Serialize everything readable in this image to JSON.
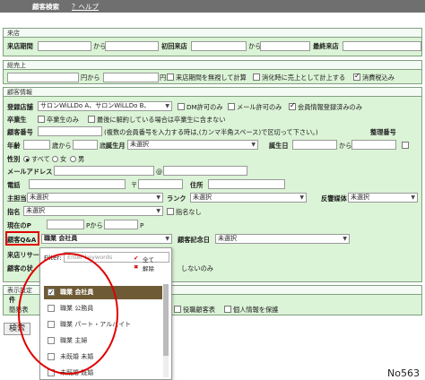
{
  "topbar": {
    "title": "顧客検索",
    "help": "？ヘルプ"
  },
  "raiten": {
    "section": "来店",
    "label_period": "来店期間",
    "from": "から",
    "label_first": "初回来店",
    "label_last": "最終来店"
  },
  "sougaku": {
    "section": "総売上",
    "yen_from": "円から",
    "yen": "円",
    "opt1": "来店期間を無視して計算",
    "opt2": "消化時に売上として計上する",
    "opt3": "消費税込み"
  },
  "kokyaku": {
    "section": "顧客情報",
    "label_store": "登録店舗",
    "store_value": "サロンWiLLDo A、サロンWiLLDo B、",
    "dm": "DM許可のみ",
    "mail": "メール許可のみ",
    "member": "会員情報登録済みのみ",
    "label_grad": "卒業生",
    "grad_only": "卒業生のみ",
    "grad_note": "最後に解約している場合は卒業生に含まない",
    "label_member_no": "顧客番号",
    "member_no_note": "(複数の会員番号を入力する時は,(カンマ半角スペース)で区切って下さい。)",
    "label_seiri": "整理番号",
    "label_age": "年齢",
    "age_from": "歳から",
    "age_to": "歳",
    "label_birth": "誕生月",
    "birth_value": "未選択",
    "label_birthday": "誕生日",
    "from": "から",
    "label_gender": "性別",
    "gender_all": "すべて",
    "gender_f": "女",
    "gender_m": "男",
    "label_mail": "メールアドレス",
    "at": "@",
    "label_tel": "電話",
    "postal": "〒",
    "label_address": "住所",
    "label_tantou": "主担当",
    "tantou_value": "未選択",
    "label_rank": "ランク",
    "rank_value": "未選択",
    "label_media": "反響媒体",
    "media_value": "未選択",
    "label_shimei": "指名",
    "shimei_value": "未選択",
    "shimei_none": "指名なし",
    "label_point": "現在のP",
    "p_from": "Pから",
    "p": "P",
    "label_qa": "顧客Q&A",
    "qa_value": "職業 会社員",
    "label_anniv": "顧客記念日",
    "anniv_value": "未選択",
    "label_risk": "来店リサー",
    "label_kokyaku_status": "顧客の状",
    "not_only": "しないのみ"
  },
  "hyouji": {
    "section": "表示設定",
    "label_ken": "件",
    "simple": "簡易表",
    "opt_role": "役職顧客表",
    "opt_privacy": "個人情報を保護"
  },
  "search_button": "検索",
  "dropdown": {
    "filter_label": "Filter:",
    "filter_placeholder": "Enter keywords",
    "select_all": "全て",
    "clear": "解除",
    "items": [
      {
        "label": "職業 会社員",
        "checked": true
      },
      {
        "label": "職業 公務員",
        "checked": false
      },
      {
        "label": "職業 パート・アルバイト",
        "checked": false
      },
      {
        "label": "職業 主婦",
        "checked": false
      },
      {
        "label": "未既婚 未婚",
        "checked": false
      },
      {
        "label": "未既婚 既婚",
        "checked": false
      }
    ]
  },
  "figure_label": "No563",
  "colors": {
    "section_bg": "#dbf3d6",
    "highlight": "#e00000",
    "selected": "#6e5b36"
  }
}
